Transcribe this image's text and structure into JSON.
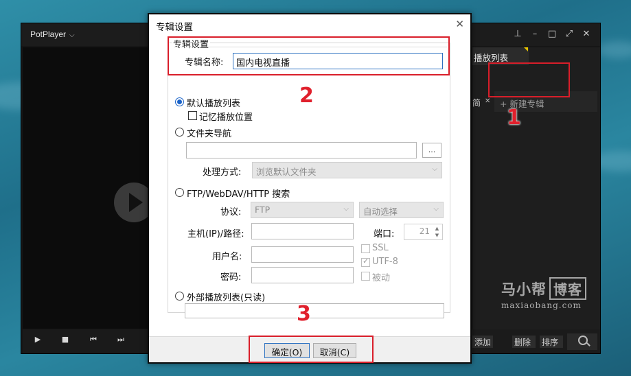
{
  "player": {
    "app_menu": "PotPlayer",
    "playlist_tab": "播放列表",
    "new_album": "+ 新建专辑",
    "add_btn": "添加",
    "delete_btn": "删除",
    "sort_btn": "排序",
    "subtab_stub": "简"
  },
  "watermark": {
    "cn_part1": "马小帮",
    "cn_part2": "博客",
    "en": "maxiaobang.com"
  },
  "dialog": {
    "title": "专辑设置",
    "group_title": "专辑设置",
    "album_name_label": "专辑名称:",
    "album_name_value": "国内电视直播",
    "default_playlist": "默认播放列表",
    "remember_pos": "记忆播放位置",
    "folder_nav": "文件夹导航",
    "browse": "...",
    "process_label": "处理方式:",
    "process_value": "浏览默认文件夹",
    "ftp_search": "FTP/WebDAV/HTTP 搜索",
    "protocol_label": "协议:",
    "protocol_value": "FTP",
    "encoding_value": "自动选择",
    "host_label": "主机(IP)/路径:",
    "port_label": "端口:",
    "port_value": "21",
    "ssl": "SSL",
    "utf8": "UTF-8",
    "passive": "被动",
    "user_label": "用户名:",
    "password_label": "密码:",
    "external_playlist": "外部播放列表(只读)",
    "ok_btn": "确定(O)",
    "cancel_btn": "取消(C)"
  },
  "annotations": [
    "1",
    "2",
    "3"
  ],
  "colors": {
    "annotation": "#d91e2a",
    "radio_accent": "#1a63c9",
    "focus_border": "#2f73c2"
  }
}
